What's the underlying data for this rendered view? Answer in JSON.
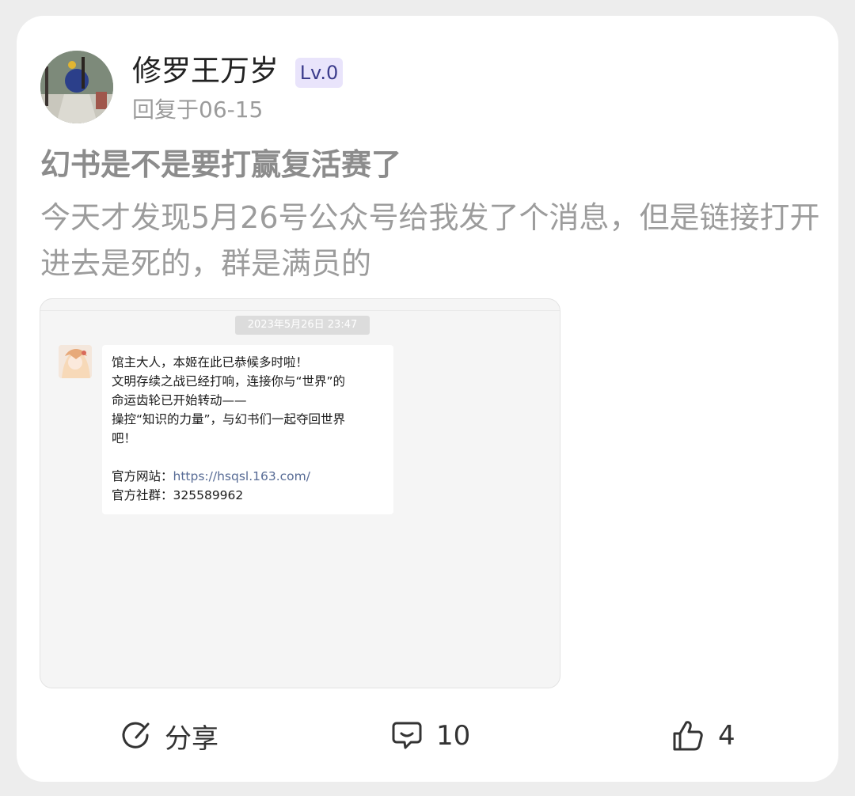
{
  "post": {
    "author": {
      "name": "修罗王万岁",
      "level": "Lv.0",
      "reply_time": "回复于06-15"
    },
    "title": "幻书是不是要打赢复活赛了",
    "body": "今天才发现5月26号公众号给我发了个消息，但是链接打开进去是死的，群是满员的"
  },
  "screenshot": {
    "timestamp": "2023年5月26日  23:47",
    "message": {
      "lines": [
        "馆主大人，本姬在此已恭候多时啦！",
        "文明存续之战已经打响，连接你与“世界”的",
        "命运齿轮已开始转动——",
        "操控“知识的力量”，与幻书们一起夺回世界",
        "吧！"
      ],
      "website_label": "官方网站：",
      "website_url": "https://hsqsl.163.com/",
      "group_label": "官方社群：",
      "group_id": "325589962"
    }
  },
  "actions": {
    "share_label": "分享",
    "comment_count": "10",
    "like_count": "4"
  },
  "icons": {
    "share": "share-icon",
    "comment": "comment-icon",
    "like": "thumbs-up-icon"
  },
  "colors": {
    "level_badge_bg": "#e9e4fb",
    "level_badge_text": "#3c3c8c",
    "link": "#576b95"
  }
}
